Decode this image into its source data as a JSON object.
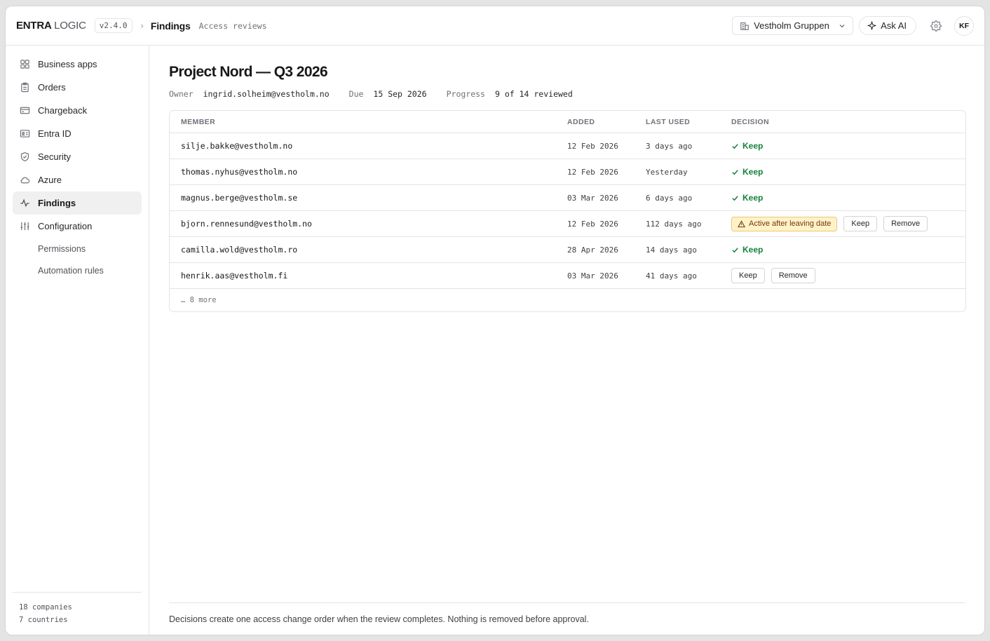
{
  "brand": {
    "name_bold": "ENTRA",
    "name_light": "LOGIC",
    "version": "v2.4.0"
  },
  "breadcrumb": {
    "title": "Findings",
    "subtitle": "Access reviews"
  },
  "topbar": {
    "tenant": "Vestholm Gruppen",
    "ask_ai": "Ask AI",
    "avatar_initials": "KF"
  },
  "sidebar": {
    "items": [
      {
        "label": "Business apps",
        "icon": "grid-icon"
      },
      {
        "label": "Orders",
        "icon": "clipboard-icon"
      },
      {
        "label": "Chargeback",
        "icon": "credit-card-icon"
      },
      {
        "label": "Entra ID",
        "icon": "id-card-icon"
      },
      {
        "label": "Security",
        "icon": "shield-icon"
      },
      {
        "label": "Azure",
        "icon": "cloud-icon"
      },
      {
        "label": "Findings",
        "icon": "activity-icon",
        "active": true
      },
      {
        "label": "Configuration",
        "icon": "sliders-icon"
      }
    ],
    "subitems": [
      "Permissions",
      "Automation rules"
    ],
    "footer": {
      "companies": "18 companies",
      "countries": "7 countries"
    }
  },
  "review": {
    "title": "Project Nord — Q3 2026",
    "owner_label": "Owner",
    "owner": "ingrid.solheim@vestholm.no",
    "due_label": "Due",
    "due": "15 Sep 2026",
    "progress_label": "Progress",
    "progress": "9 of 14 reviewed"
  },
  "table": {
    "columns": [
      "MEMBER",
      "ADDED",
      "LAST USED",
      "DECISION"
    ],
    "rows": [
      {
        "member": "silje.bakke@vestholm.no",
        "added": "12 Feb 2026",
        "last_used": "3 days ago",
        "decision": "Keep"
      },
      {
        "member": "thomas.nyhus@vestholm.no",
        "added": "12 Feb 2026",
        "last_used": "Yesterday",
        "decision": "Keep"
      },
      {
        "member": "magnus.berge@vestholm.se",
        "added": "03 Mar 2026",
        "last_used": "6 days ago",
        "decision": "Keep"
      },
      {
        "member": "bjorn.rennesund@vestholm.no",
        "added": "12 Feb 2026",
        "last_used": "112 days ago",
        "warning": "Active after leaving date",
        "keep_label": "Keep",
        "remove_label": "Remove"
      },
      {
        "member": "camilla.wold@vestholm.ro",
        "added": "28 Apr 2026",
        "last_used": "14 days ago",
        "decision": "Keep"
      },
      {
        "member": "henrik.aas@vestholm.fi",
        "added": "03 Mar 2026",
        "last_used": "41 days ago",
        "keep_label": "Keep",
        "remove_label": "Remove"
      }
    ],
    "more": "… 8 more"
  },
  "footnote": "Decisions create one access change order when the review completes. Nothing is removed before approval.",
  "colors": {
    "keep_green": "#15803d",
    "warning_bg": "#fef3c7",
    "warning_border": "#f5c27a"
  }
}
